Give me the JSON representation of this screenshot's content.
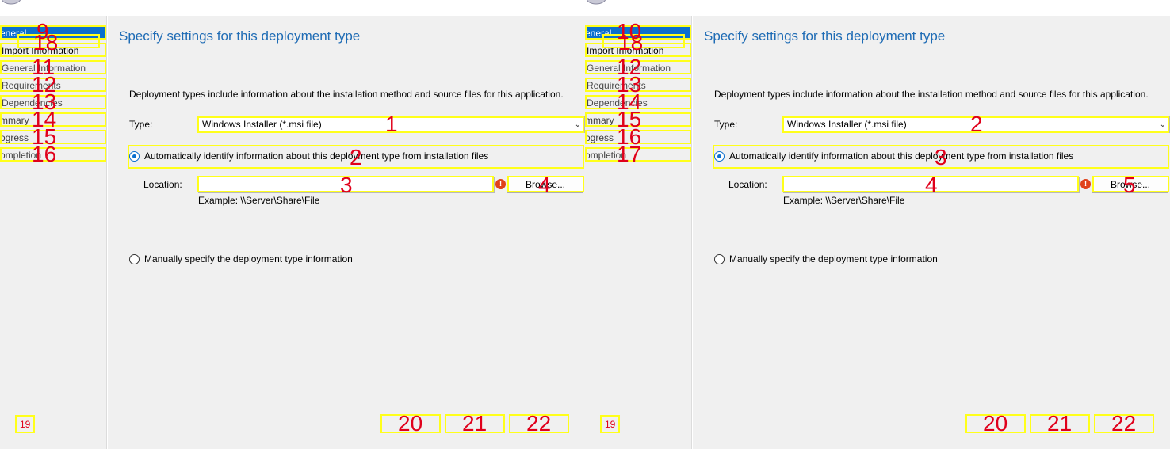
{
  "title": "Specify settings for this deployment type",
  "nav": {
    "items": [
      {
        "label": "eneral",
        "active": true
      },
      {
        "label": "Import Information",
        "active": false
      },
      {
        "label": "General Information",
        "active": false
      },
      {
        "label": "Requirements",
        "active": false
      },
      {
        "label": "Dependencies",
        "active": false
      },
      {
        "label": "mmary",
        "active": false
      },
      {
        "label": "ogress",
        "active": false
      },
      {
        "label": "ompletion",
        "active": false
      }
    ]
  },
  "main": {
    "description": "Deployment types include information about the installation method and source files for this application.",
    "type_label": "Type:",
    "type_value": "Windows Installer (*.msi file)",
    "auto_radio_label": "Automatically identify information about this deployment type from installation files",
    "location_label": "Location:",
    "location_value": "",
    "browse_label": "Browse...",
    "example_text": "Example: \\\\Server\\Share\\File",
    "manual_radio_label": "Manually specify the deployment type information"
  },
  "annotations": {
    "left": {
      "type_select": "1",
      "auto_radio": "2",
      "location_input": "3",
      "browse_button": "4",
      "nav": [
        "9",
        "18",
        "11",
        "12",
        "13",
        "14",
        "15",
        "16"
      ],
      "footer": [
        "19",
        "20",
        "21",
        "22"
      ]
    },
    "right": {
      "type_select": "2",
      "auto_radio": "3",
      "location_input": "4",
      "browse_button": "5",
      "nav": [
        "10",
        "18",
        "12",
        "13",
        "14",
        "15",
        "16",
        "17"
      ],
      "footer": [
        "19",
        "20",
        "21",
        "22"
      ]
    }
  },
  "colors": {
    "accent": "#0b6fce",
    "title": "#1f6cb5",
    "annotation_box": "#ffff1a",
    "annotation_number": "#e0001b",
    "error": "#e0421a"
  }
}
